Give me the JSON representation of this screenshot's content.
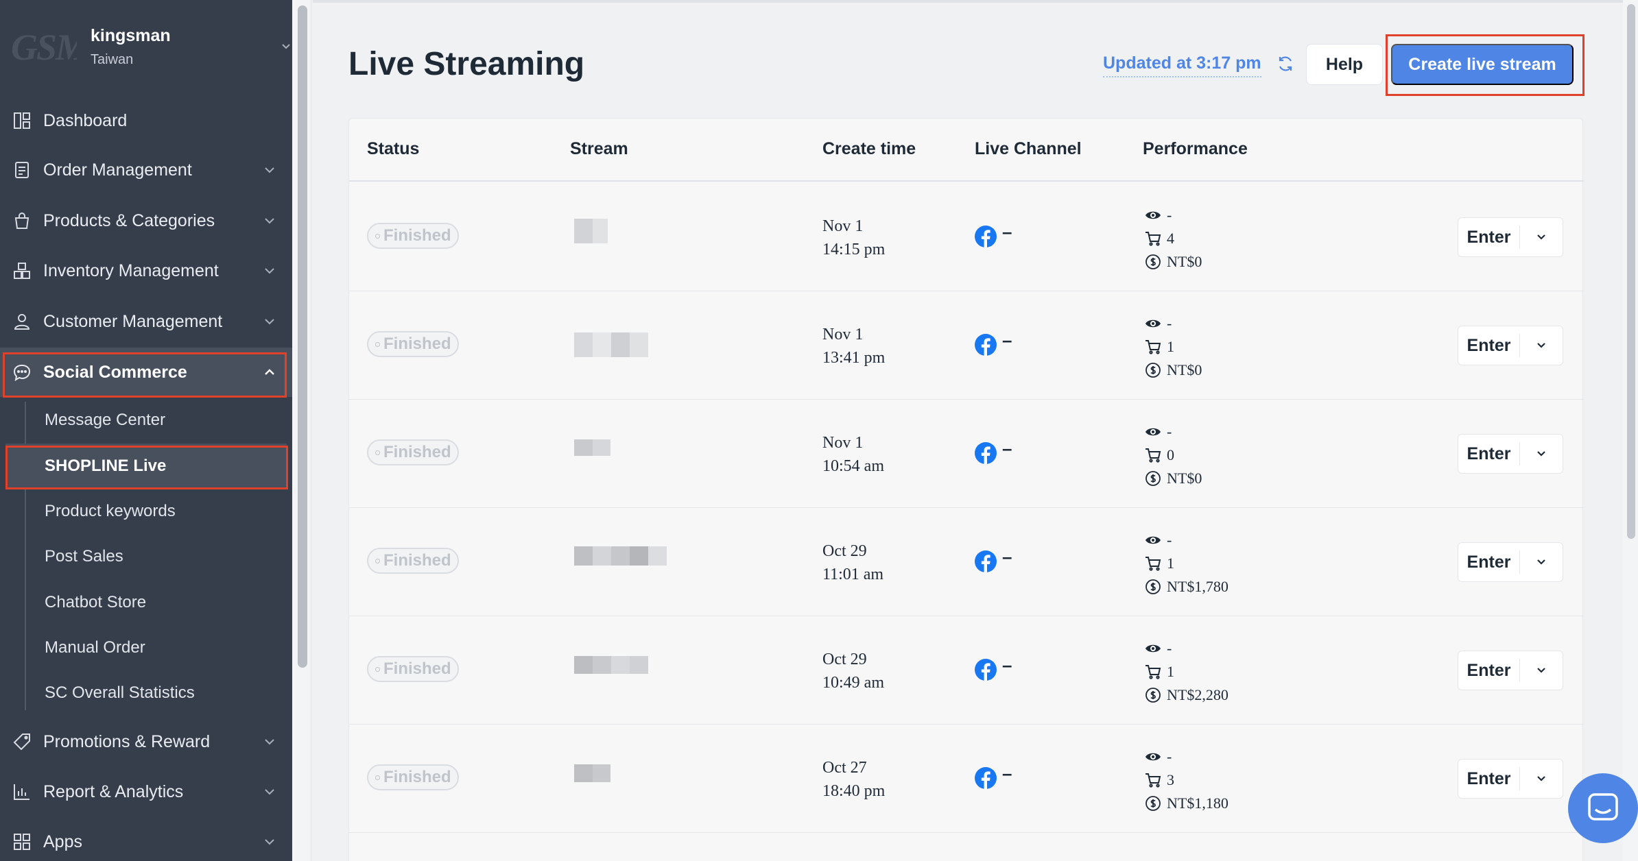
{
  "account": {
    "logo_text": "GSM",
    "name": "kingsman",
    "region": "Taiwan"
  },
  "sidebar": {
    "items": [
      {
        "id": "dashboard",
        "label": "Dashboard",
        "icon": "dashboard-icon"
      },
      {
        "id": "order",
        "label": "Order Management",
        "icon": "order-icon"
      },
      {
        "id": "products",
        "label": "Products & Categories",
        "icon": "bag-icon"
      },
      {
        "id": "inventory",
        "label": "Inventory Management",
        "icon": "inventory-icon"
      },
      {
        "id": "customer",
        "label": "Customer Management",
        "icon": "user-icon"
      },
      {
        "id": "social",
        "label": "Social Commerce",
        "icon": "chat-icon",
        "expanded": true
      },
      {
        "id": "promotions",
        "label": "Promotions & Reward",
        "icon": "tag-icon"
      },
      {
        "id": "report",
        "label": "Report & Analytics",
        "icon": "chart-icon"
      },
      {
        "id": "apps",
        "label": "Apps",
        "icon": "apps-icon"
      }
    ],
    "social_sub": [
      "Message Center",
      "SHOPLINE Live",
      "Product keywords",
      "Post Sales",
      "Chatbot Store",
      "Manual Order",
      "SC Overall Statistics"
    ],
    "active_sub": "SHOPLINE Live"
  },
  "header": {
    "title": "Live Streaming",
    "updated": "Updated at 3:17 pm",
    "help": "Help",
    "create": "Create live stream"
  },
  "table": {
    "columns": [
      "Status",
      "Stream",
      "Create time",
      "Live Channel",
      "Performance"
    ],
    "enter_label": "Enter",
    "rows": [
      {
        "status": "Finished",
        "date": "Nov 1",
        "time": "14:15 pm",
        "channel": "–",
        "views": "-",
        "orders": "4",
        "revenue": "NT$0"
      },
      {
        "status": "Finished",
        "date": "Nov 1",
        "time": "13:41 pm",
        "channel": "–",
        "views": "-",
        "orders": "1",
        "revenue": "NT$0"
      },
      {
        "status": "Finished",
        "date": "Nov 1",
        "time": "10:54 am",
        "channel": "–",
        "views": "-",
        "orders": "0",
        "revenue": "NT$0"
      },
      {
        "status": "Finished",
        "date": "Oct 29",
        "time": "11:01 am",
        "channel": "–",
        "views": "-",
        "orders": "1",
        "revenue": "NT$1,780"
      },
      {
        "status": "Finished",
        "date": "Oct 29",
        "time": "10:49 am",
        "channel": "–",
        "views": "-",
        "orders": "1",
        "revenue": "NT$2,280"
      },
      {
        "status": "Finished",
        "date": "Oct 27",
        "time": "18:40 pm",
        "channel": "–",
        "views": "-",
        "orders": "3",
        "revenue": "NT$1,180"
      }
    ]
  },
  "colors": {
    "sidebar": "#363e4c",
    "accent": "#4f86e6",
    "highlight": "#e0412a"
  }
}
